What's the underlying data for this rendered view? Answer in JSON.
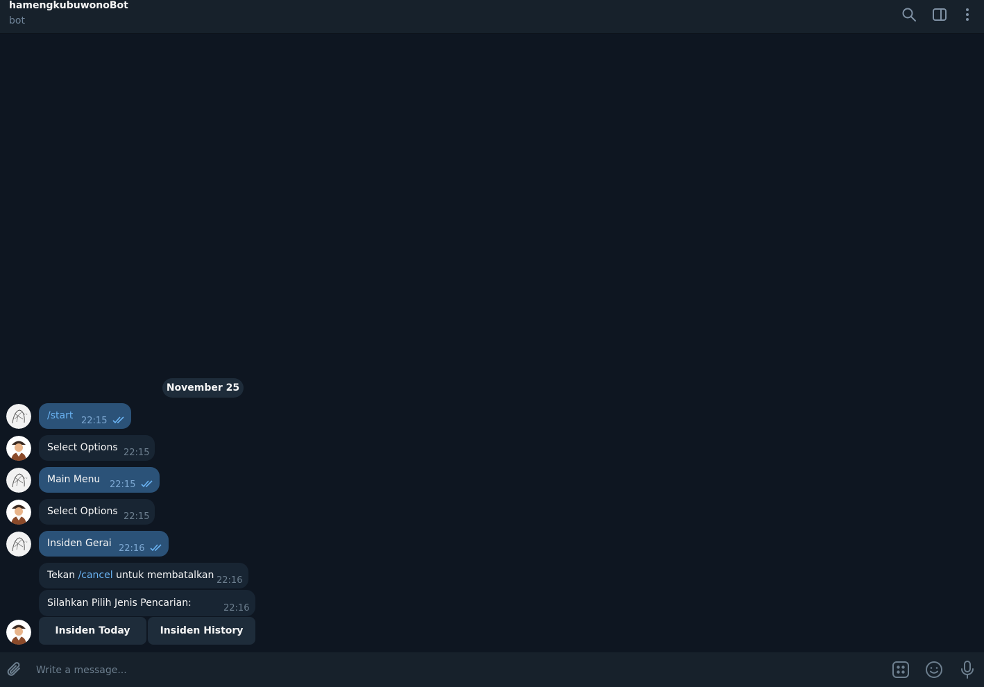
{
  "header": {
    "title": "hamengkubuwonoBot",
    "subtitle": "bot",
    "icons": [
      "search-icon",
      "sidebar-toggle-icon",
      "more-vertical-icon"
    ]
  },
  "date_separator": "November 25",
  "messages": [
    {
      "direction": "out",
      "text": "/start",
      "time": "22:15",
      "status": "read"
    },
    {
      "direction": "in",
      "text": "Select Options",
      "time": "22:15"
    },
    {
      "direction": "out",
      "text": "Main Menu",
      "time": "22:15",
      "status": "read"
    },
    {
      "direction": "in",
      "text": "Select Options",
      "time": "22:15"
    },
    {
      "direction": "out",
      "text": "Insiden Gerai",
      "time": "22:16",
      "status": "read"
    },
    {
      "direction": "in",
      "text_before": "Tekan ",
      "command": "/cancel",
      "text_after": " untuk membatalkan",
      "time": "22:16"
    },
    {
      "direction": "in",
      "text": "Silahkan Pilih Jenis Pencarian:",
      "time": "22:16"
    }
  ],
  "inline_keyboard": [
    "Insiden Today",
    "Insiden History"
  ],
  "composer": {
    "placeholder": "Write a message...",
    "icons": [
      "attach-icon",
      "bot-menu-icon",
      "emoji-icon",
      "microphone-icon"
    ]
  },
  "colors": {
    "background": "#0e1621",
    "header": "#17212b",
    "outgoing_bubble": "#2b5278",
    "incoming_bubble": "#182533",
    "link": "#6ab3f3",
    "read_ticks": "#6ab3f3"
  }
}
